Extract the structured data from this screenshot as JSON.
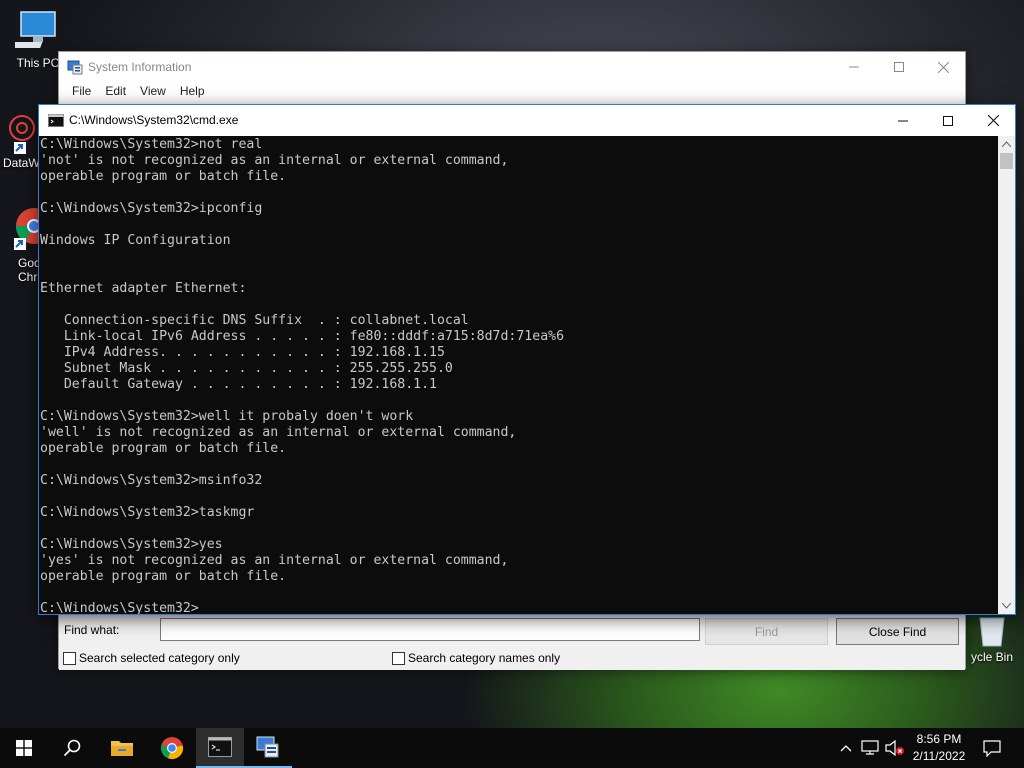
{
  "desktop": {
    "icons": [
      {
        "label": "This PC"
      },
      {
        "label": "DataW"
      },
      {
        "label": "Goo Chro"
      },
      {
        "label": "ycle Bin"
      }
    ]
  },
  "sysinfo": {
    "title": "System Information",
    "menu": [
      "File",
      "Edit",
      "View",
      "Help"
    ],
    "find_label": "Find what:",
    "find_value": "",
    "find_button": "Find",
    "close_find_button": "Close Find",
    "chk_selected": "Search selected category only",
    "chk_names": "Search category names only"
  },
  "cmd": {
    "title": "C:\\Windows\\System32\\cmd.exe",
    "lines": [
      "C:\\Windows\\System32>not real",
      "'not' is not recognized as an internal or external command,",
      "operable program or batch file.",
      "",
      "C:\\Windows\\System32>ipconfig",
      "",
      "Windows IP Configuration",
      "",
      "",
      "Ethernet adapter Ethernet:",
      "",
      "   Connection-specific DNS Suffix  . : collabnet.local",
      "   Link-local IPv6 Address . . . . . : fe80::dddf:a715:8d7d:71ea%6",
      "   IPv4 Address. . . . . . . . . . . : 192.168.1.15",
      "   Subnet Mask . . . . . . . . . . . : 255.255.255.0",
      "   Default Gateway . . . . . . . . . : 192.168.1.1",
      "",
      "C:\\Windows\\System32>well it probaly doen't work",
      "'well' is not recognized as an internal or external command,",
      "operable program or batch file.",
      "",
      "C:\\Windows\\System32>msinfo32",
      "",
      "C:\\Windows\\System32>taskmgr",
      "",
      "C:\\Windows\\System32>yes",
      "'yes' is not recognized as an internal or external command,",
      "operable program or batch file.",
      "",
      "C:\\Windows\\System32>"
    ]
  },
  "taskbar": {
    "time": "8:56 PM",
    "date": "2/11/2022"
  },
  "colors": {
    "accent": "#76b9ed",
    "console_bg": "#0c0c0c",
    "console_fg": "#c8c8c8"
  }
}
